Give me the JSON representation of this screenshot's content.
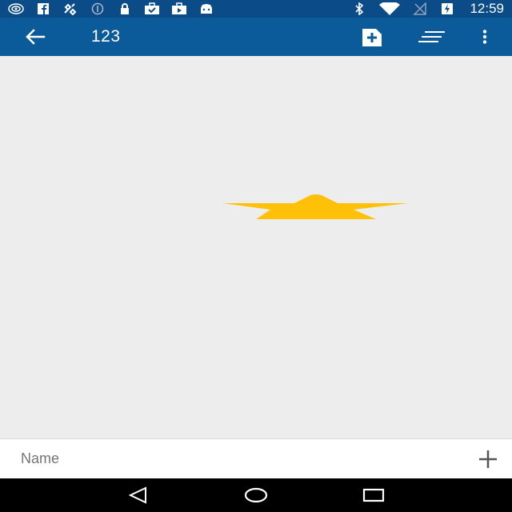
{
  "status_bar": {
    "time": "12:59",
    "left_icons": [
      "broadcast-icon",
      "facebook-icon",
      "satellite-icon",
      "info-icon",
      "lock-icon",
      "briefcase-check-icon",
      "briefcase-icon",
      "android-icon"
    ],
    "right_icons": [
      "bluetooth-icon",
      "wifi-icon",
      "no-signal-icon",
      "battery-charging-icon"
    ]
  },
  "app_bar": {
    "title": "123",
    "back_icon": "arrow-back-icon",
    "actions": [
      "add-document-icon",
      "sort-lines-icon",
      "more-vert-icon"
    ]
  },
  "canvas": {
    "shape": "star",
    "shape_color": "#ffc107"
  },
  "entry": {
    "placeholder": "Name",
    "value": "",
    "add_icon": "plus-icon"
  },
  "nav_bar": {
    "buttons": [
      "back-triangle-icon",
      "home-circle-icon",
      "recents-square-icon"
    ]
  },
  "colors": {
    "status_bar": "#0b4b87",
    "app_bar": "#0b5b9b",
    "background": "#ededed",
    "accent_star": "#ffc107"
  }
}
